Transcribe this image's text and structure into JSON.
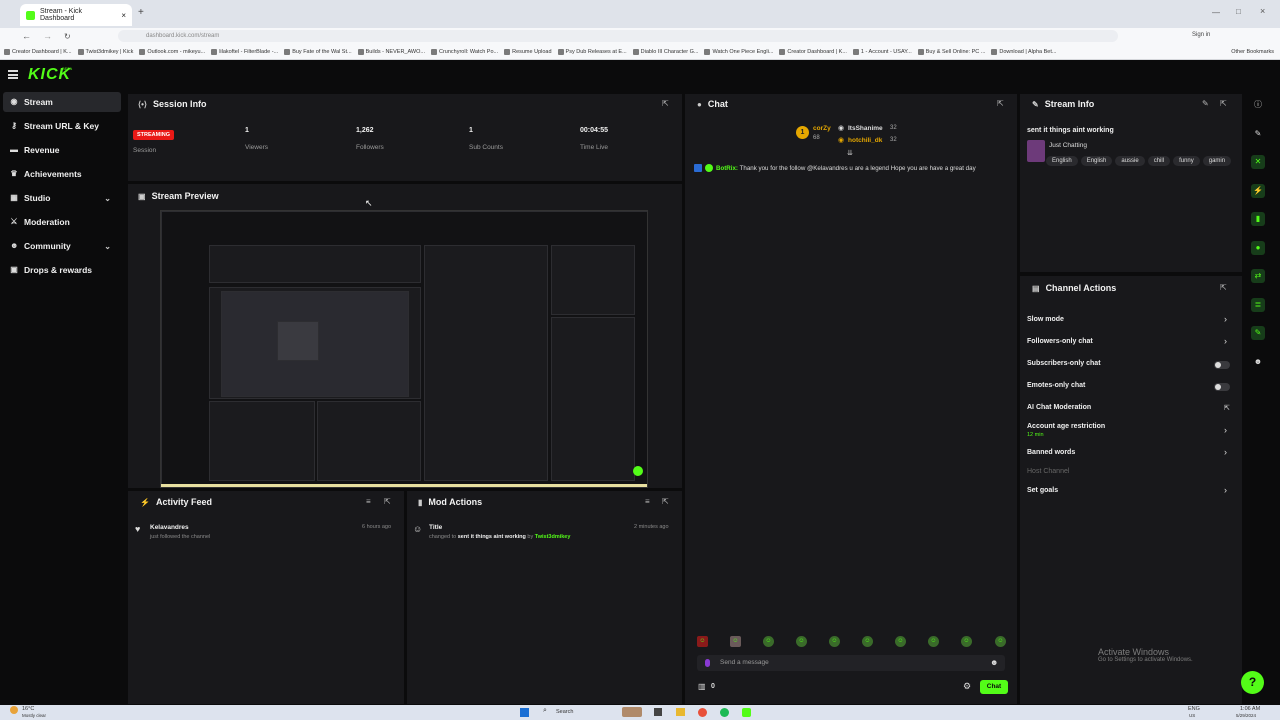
{
  "browser": {
    "tab_title": "Stream - Kick Dashboard",
    "url": "dashboard.kick.com/stream",
    "signin": "Sign in",
    "bookmarks": [
      "Creator Dashboard | K...",
      "Twist3dmikey | Kick",
      "Outlook.com - mikeyu...",
      "lilakoftel - FilterBlade -...",
      "Buy Fate of the Wal St...",
      "Builds - NEVER_AWO...",
      "Crunchyroll: Watch Po...",
      "Resume Upload",
      "Psy Dub Releases at E...",
      "Diablo III Character G...",
      "Watch One Piece Engli...",
      "Creator Dashboard | K...",
      "1 - Account - USAY...",
      "Buy & Sell Online: PC ...",
      "Download | Alpha Bet..."
    ],
    "other_bookmarks": "Other Bookmarks"
  },
  "app": {
    "logo": "KICK",
    "beta": "BETA"
  },
  "sidebar": {
    "items": [
      {
        "label": "Stream",
        "icon": "broadcast-icon"
      },
      {
        "label": "Stream URL & Key",
        "icon": "key-icon"
      },
      {
        "label": "Revenue",
        "icon": "revenue-icon"
      },
      {
        "label": "Achievements",
        "icon": "trophy-icon"
      },
      {
        "label": "Studio",
        "icon": "studio-icon"
      },
      {
        "label": "Moderation",
        "icon": "sword-icon"
      },
      {
        "label": "Community",
        "icon": "people-icon"
      },
      {
        "label": "Drops & rewards",
        "icon": "gift-icon"
      }
    ]
  },
  "session": {
    "title": "Session Info",
    "status": "STREAMING",
    "status_label": "Session",
    "stats": [
      {
        "value": "1",
        "label": "Viewers"
      },
      {
        "value": "1,262",
        "label": "Followers"
      },
      {
        "value": "1",
        "label": "Sub Counts"
      },
      {
        "value": "00:04:55",
        "label": "Time Live"
      }
    ]
  },
  "preview": {
    "title": "Stream Preview"
  },
  "activity": {
    "title": "Activity Feed",
    "items": [
      {
        "name": "Kelavandres",
        "action": "just followed the channel",
        "time": "6 hours ago"
      }
    ]
  },
  "mod_actions": {
    "title": "Mod Actions",
    "items": [
      {
        "name": "Title",
        "pre": "changed to",
        "value": "sent it things aint working",
        "by": "by",
        "user": "Twist3dmikey",
        "time": "2 minutes ago"
      }
    ]
  },
  "chat": {
    "title": "Chat",
    "pinned": [
      {
        "name": "corZy",
        "count": "68"
      },
      {
        "name": "ItsShanime",
        "count": "32"
      },
      {
        "name": "hotchili_dk",
        "count": "32"
      }
    ],
    "messages": [
      {
        "user": "BotRix:",
        "text": "Thank you for the follow @Kelavandres u are a legend Hope you are have a great day"
      }
    ],
    "placeholder": "Send a message",
    "counter": "0",
    "send_label": "Chat"
  },
  "stream_info": {
    "title": "Stream Info",
    "stream_title": "sent it things aint working",
    "category": "Just Chatting",
    "tags": [
      "English",
      "English",
      "aussie",
      "chill",
      "funny",
      "gamin"
    ]
  },
  "channel_actions": {
    "title": "Channel Actions",
    "items": [
      {
        "label": "Slow mode",
        "control": "arrow"
      },
      {
        "label": "Followers-only chat",
        "control": "arrow"
      },
      {
        "label": "Subscribers-only chat",
        "control": "toggle"
      },
      {
        "label": "Emotes-only chat",
        "control": "toggle"
      },
      {
        "label": "AI Chat Moderation",
        "control": "external"
      },
      {
        "label": "Account age restriction",
        "sub": "12 min",
        "control": "arrow"
      },
      {
        "label": "Banned words",
        "control": "arrow"
      },
      {
        "label": "Host Channel",
        "control": "none",
        "disabled": true
      },
      {
        "label": "Set goals",
        "control": "arrow"
      }
    ]
  },
  "windows": {
    "activate_title": "Activate Windows",
    "activate_sub": "Go to Settings to activate Windows.",
    "search": "Search",
    "weather": "16°C",
    "weather_sub": "Mostly clear",
    "lang": "ENG",
    "lang_sub": "US",
    "time": "1:06 AM",
    "date": "5/29/2024"
  },
  "colors": {
    "accent": "#53fc18",
    "live": "#e91916",
    "panel": "#18181b",
    "bg": "#0b0b0c"
  }
}
